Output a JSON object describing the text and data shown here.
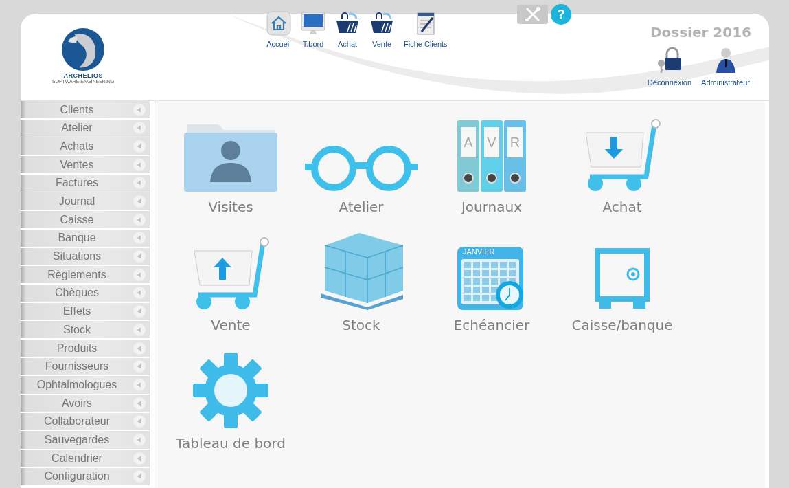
{
  "logo": {
    "name": "ARCHELIOS",
    "tagline": "SOFTWARE ENGINEERING"
  },
  "top_nav": [
    {
      "label": "Accueil",
      "kind": "home"
    },
    {
      "label": "T.bord",
      "kind": "monitor"
    },
    {
      "label": "Achat",
      "kind": "basket"
    },
    {
      "label": "Vente",
      "kind": "basket"
    },
    {
      "label": "Fiche Clients",
      "kind": "notepad"
    }
  ],
  "help": {
    "label": "?"
  },
  "dossier": "Dossier 2016",
  "user_actions": [
    {
      "label": "Déconnexion",
      "kind": "lock"
    },
    {
      "label": "Administrateur",
      "kind": "user"
    }
  ],
  "sidebar": {
    "items": [
      {
        "label": "Clients"
      },
      {
        "label": "Atelier"
      },
      {
        "label": "Achats"
      },
      {
        "label": "Ventes"
      },
      {
        "label": "Factures"
      },
      {
        "label": "Journal"
      },
      {
        "label": "Caisse"
      },
      {
        "label": "Banque"
      },
      {
        "label": "Situations"
      },
      {
        "label": "Règlements"
      },
      {
        "label": "Chèques"
      },
      {
        "label": "Effets"
      },
      {
        "label": "Stock"
      },
      {
        "label": "Produits"
      },
      {
        "label": "Fournisseurs"
      },
      {
        "label": "Ophtalmologues"
      },
      {
        "label": "Avoirs"
      },
      {
        "label": "Collaborateur"
      },
      {
        "label": "Sauvegardes"
      },
      {
        "label": "Calendrier"
      },
      {
        "label": "Configuration"
      }
    ]
  },
  "tiles": [
    {
      "label": "Visites",
      "kind": "folder"
    },
    {
      "label": "Atelier",
      "kind": "glasses"
    },
    {
      "label": "Journaux",
      "kind": "binders",
      "binder_letters": [
        "A",
        "V",
        "R"
      ]
    },
    {
      "label": "Achat",
      "kind": "cart-down"
    },
    {
      "label": "Vente",
      "kind": "cart-up"
    },
    {
      "label": "Stock",
      "kind": "boxes"
    },
    {
      "label": "Echéancier",
      "kind": "calendar",
      "month": "JANVIER"
    },
    {
      "label": "Caisse/banque",
      "kind": "safe"
    },
    {
      "label": "Tableau de bord",
      "kind": "gear"
    }
  ]
}
